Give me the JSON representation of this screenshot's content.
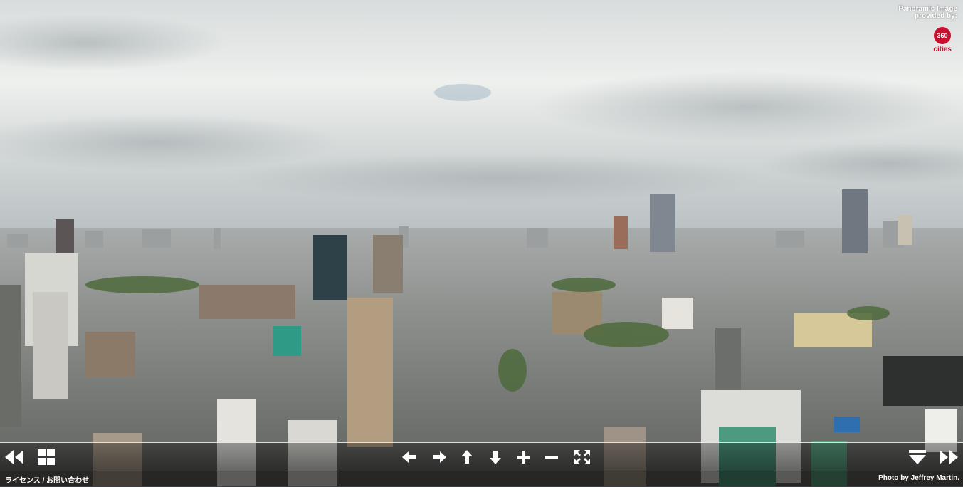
{
  "credit": {
    "line1": "Panoramic Image",
    "line2": "provided by:",
    "logo_number": "360",
    "logo_word": "cities"
  },
  "footer": {
    "left_link": "ライセンス / お問い合わせ",
    "photo_credit": "Photo by Jeffrey Martin."
  },
  "colors": {
    "logo_red": "#c8102e",
    "toolbar_icon": "#ffffff"
  },
  "toolbar": {
    "icons": [
      "rewind-icon",
      "grid-icon",
      "arrow-left-icon",
      "arrow-right-icon",
      "arrow-up-icon",
      "arrow-down-icon",
      "zoom-in-icon",
      "zoom-out-icon",
      "fullscreen-icon",
      "hide-menu-icon",
      "fast-forward-icon"
    ]
  }
}
